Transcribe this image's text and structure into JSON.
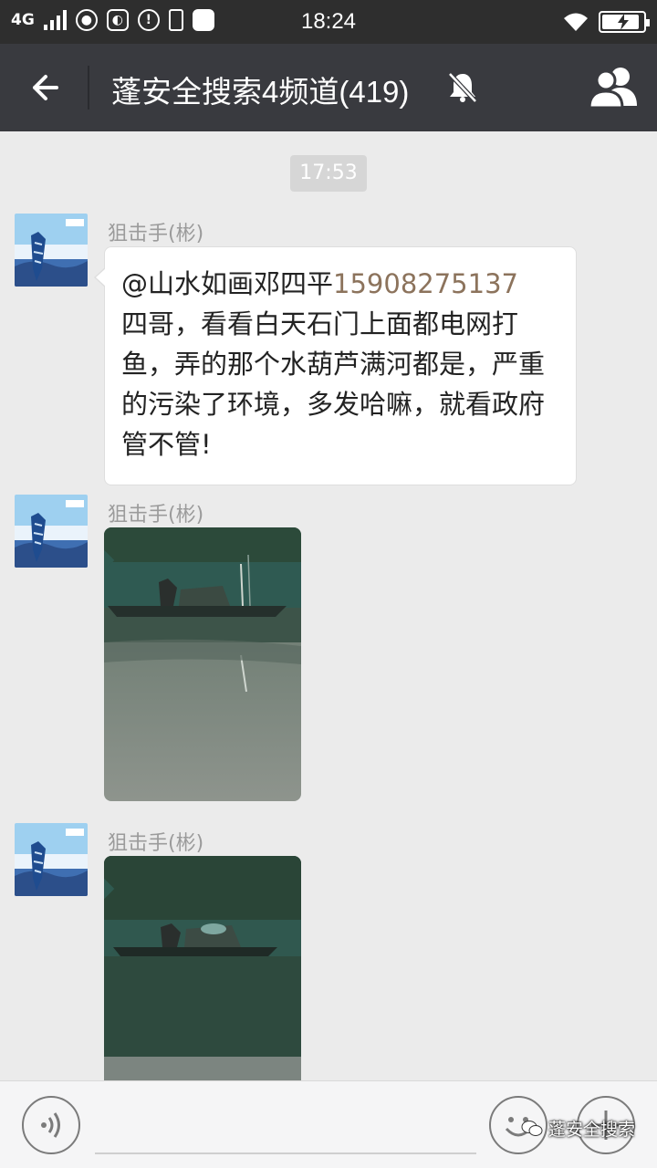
{
  "status_bar": {
    "network": "4G",
    "time": "18:24",
    "icons": [
      "signal-icon",
      "wechat-icon",
      "app-icon",
      "alert-icon",
      "phone-icon",
      "bag-icon",
      "wifi-icon",
      "battery-charging-icon"
    ],
    "battery_level": 0.9
  },
  "navbar": {
    "title": "蓬安全搜索4频道(419)",
    "icons": [
      "back-arrow-icon",
      "mute-bell-icon",
      "group-members-icon"
    ]
  },
  "chat": {
    "timestamp": "17:53",
    "messages": [
      {
        "sender": "狙击手(彬)",
        "type": "text",
        "text_prefix": "@山水如画邓四平",
        "phone": "15908275137",
        "text_body": "四哥，看看白天石门上面都电网打鱼，弄的那个水葫芦满河都是，严重的污染了环境，多发哈嘛，就看政府管不管!"
      },
      {
        "sender": "狙击手(彬)",
        "type": "image",
        "image_desc": "river-boat-photo"
      },
      {
        "sender": "狙击手(彬)",
        "type": "image",
        "image_desc": "river-boat-photo"
      }
    ]
  },
  "input_bar": {
    "icons": [
      "voice-icon",
      "emoji-icon",
      "plus-icon"
    ],
    "watermark": "蓬安全搜索"
  },
  "colors": {
    "statusbar_bg": "#2e2e2e",
    "navbar_bg": "#393a3f",
    "chat_bg": "#ebebeb",
    "phone_link": "#8c735c"
  }
}
